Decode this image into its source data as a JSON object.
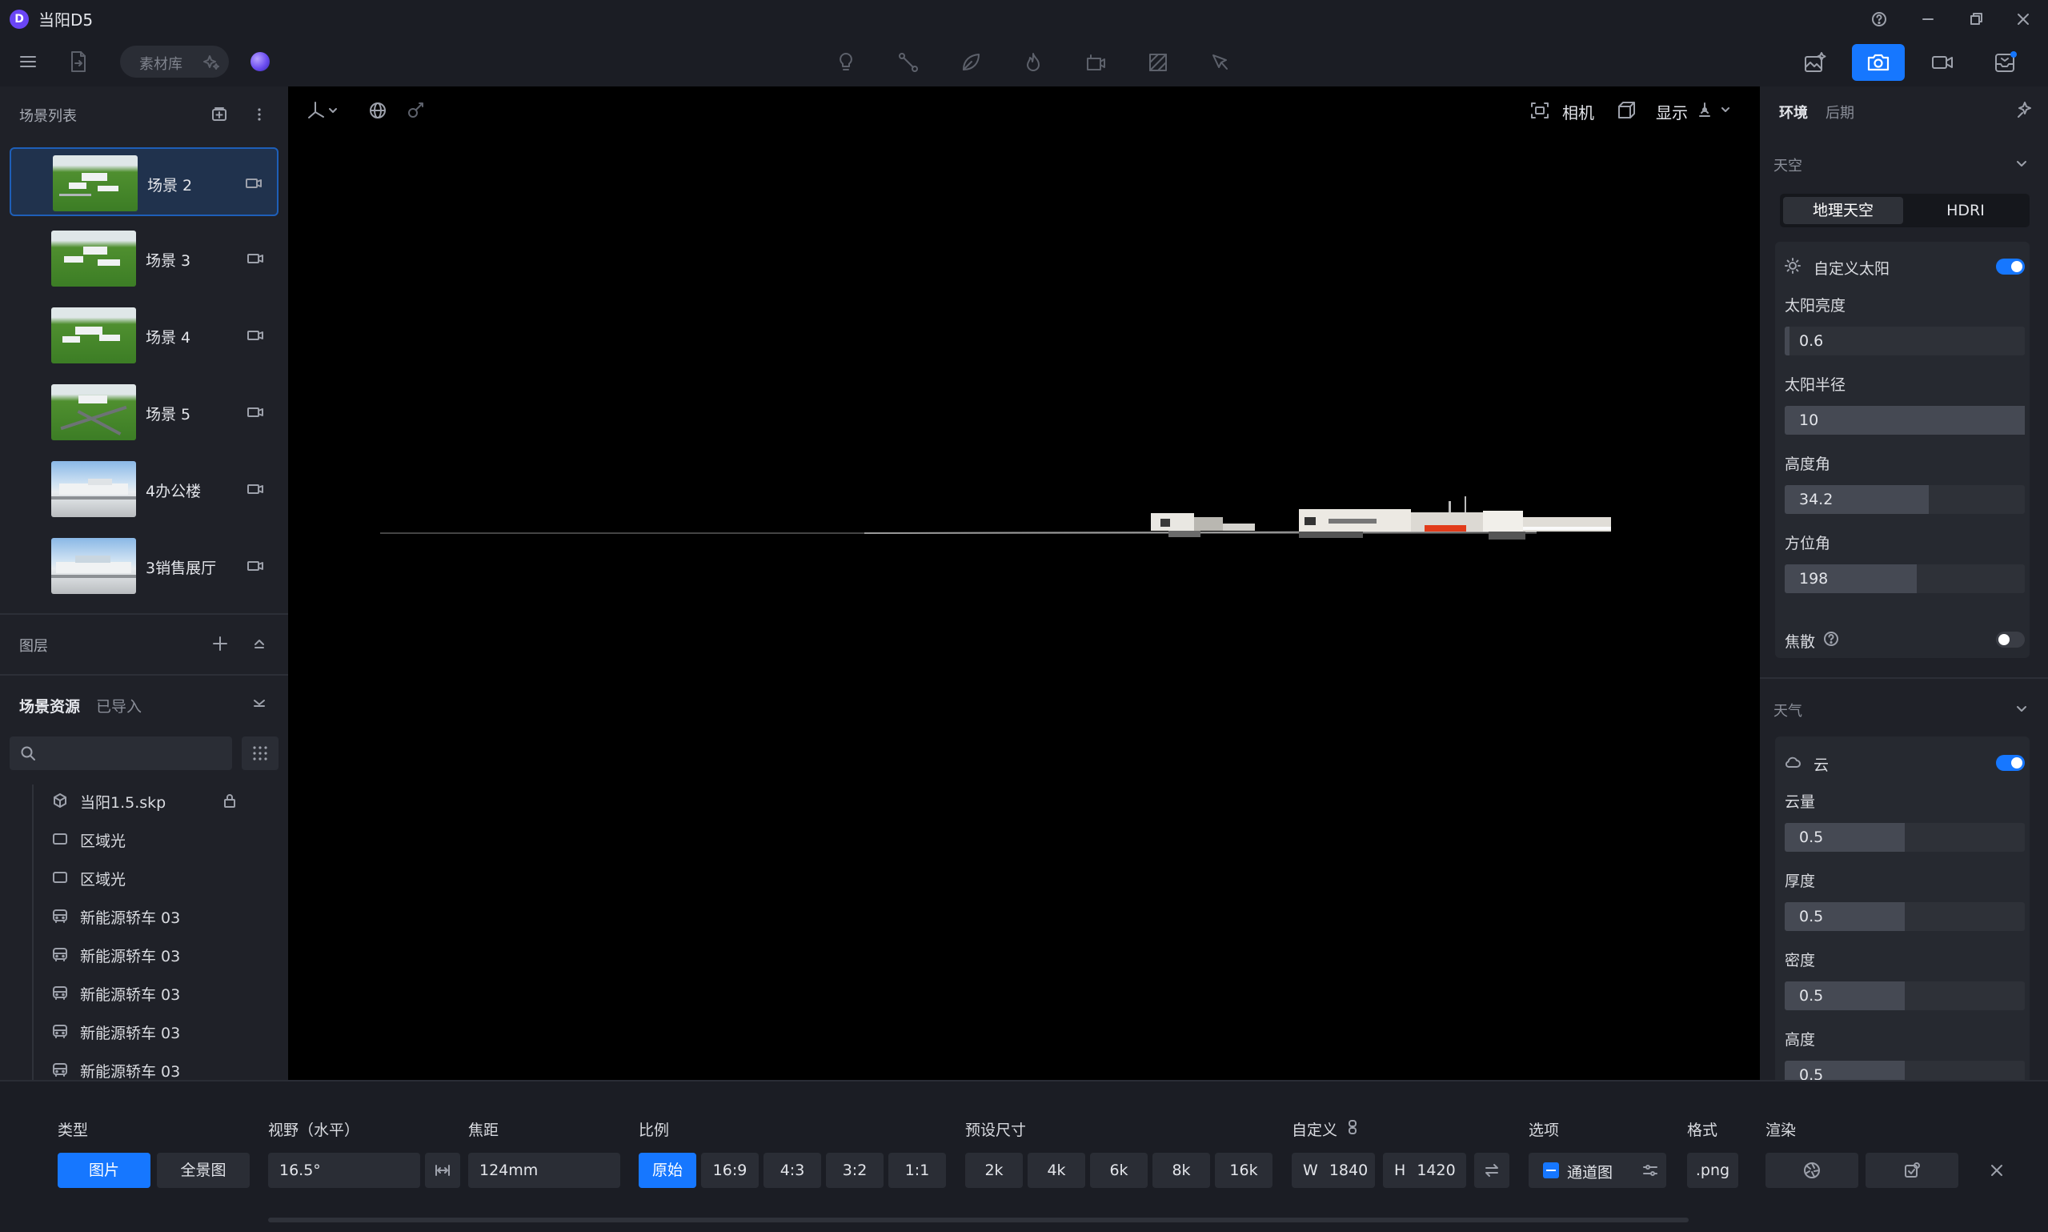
{
  "app": {
    "logo_letter": "D",
    "title": "当阳D5"
  },
  "toolbar": {
    "asset_library": "素材库"
  },
  "left": {
    "scene_list_title": "场景列表",
    "scenes": [
      {
        "label": "场景 2",
        "active": true
      },
      {
        "label": "场景 3"
      },
      {
        "label": "场景 4"
      },
      {
        "label": "场景 5"
      },
      {
        "label": "4办公楼"
      },
      {
        "label": "3销售展厅"
      }
    ],
    "layers_title": "图层",
    "assets_tab_scene": "场景资源",
    "assets_tab_imported": "已导入",
    "search_placeholder": "",
    "assets": [
      {
        "label": "当阳1.5.skp",
        "icon": "cube-icon"
      },
      {
        "label": "区域光",
        "icon": "area-light-icon"
      },
      {
        "label": "区域光",
        "icon": "area-light-icon"
      },
      {
        "label": "新能源轿车 03",
        "icon": "car-icon"
      },
      {
        "label": "新能源轿车 03",
        "icon": "car-icon"
      },
      {
        "label": "新能源轿车 03",
        "icon": "car-icon"
      },
      {
        "label": "新能源轿车 03",
        "icon": "car-icon"
      },
      {
        "label": "新能源轿车 03",
        "icon": "car-icon"
      }
    ]
  },
  "viewport": {
    "camera_label": "相机",
    "display_label": "显示"
  },
  "right": {
    "tab_environment": "环境",
    "tab_post": "后期",
    "sky": {
      "title": "天空",
      "tab_geo": "地理天空",
      "tab_hdri": "HDRI",
      "custom_sun": "自定义太阳",
      "custom_sun_on": true,
      "sun_brightness_label": "太阳亮度",
      "sun_brightness": "0.6",
      "sun_brightness_level": 0.02,
      "sun_radius_label": "太阳半径",
      "sun_radius": "10",
      "sun_radius_level": 1.0,
      "elevation_label": "高度角",
      "elevation": "34.2",
      "elevation_level": 0.6,
      "azimuth_label": "方位角",
      "azimuth": "198",
      "azimuth_level": 0.55,
      "caustics_label": "焦散",
      "caustics_on": false
    },
    "weather": {
      "title": "天气",
      "cloud_label": "云",
      "cloud_on": true,
      "cloud_amount_label": "云量",
      "cloud_amount": "0.5",
      "thickness_label": "厚度",
      "thickness": "0.5",
      "density_label": "密度",
      "density": "0.5",
      "height_label": "高度",
      "height": "0.5",
      "level": 0.5
    }
  },
  "bottom": {
    "type_label": "类型",
    "type_image": "图片",
    "type_panorama": "全景图",
    "fov_label": "视野（水平）",
    "fov_value": "16.5°",
    "focal_label": "焦距",
    "focal_value": "124mm",
    "ratio_label": "比例",
    "ratios": [
      "原始",
      "16:9",
      "4:3",
      "3:2",
      "1:1"
    ],
    "preset_label": "预设尺寸",
    "presets": [
      "2k",
      "4k",
      "6k",
      "8k",
      "16k"
    ],
    "custom_label": "自定义",
    "width_prefix": "W",
    "width": "1840",
    "height_prefix": "H",
    "height": "1420",
    "options_label": "选项",
    "channel_label": "通道图",
    "format_label": "格式",
    "format_value": ".png",
    "render_label": "渲染"
  },
  "colors": {
    "accent": "#1677ff",
    "panel": "#1f2128",
    "viewport": "#000000"
  }
}
